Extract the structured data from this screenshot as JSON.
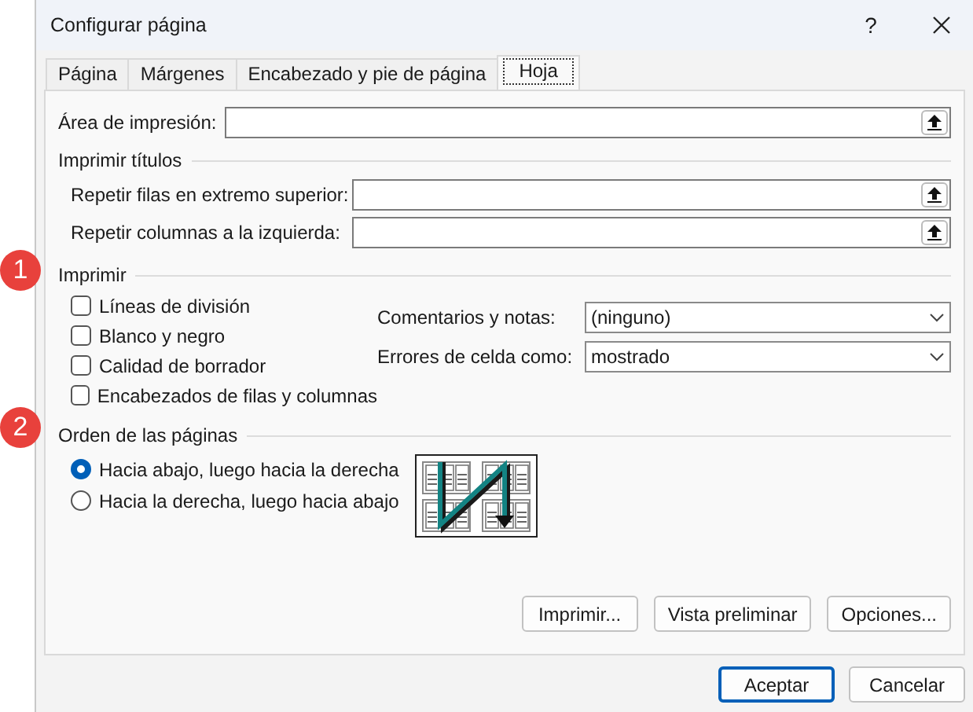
{
  "window": {
    "title": "Configurar página",
    "help": "?"
  },
  "tabs": [
    {
      "label": "Página",
      "selected": false
    },
    {
      "label": "Márgenes",
      "selected": false
    },
    {
      "label": "Encabezado y pie de página",
      "selected": false
    },
    {
      "label": "Hoja",
      "selected": true
    }
  ],
  "print_area": {
    "label": "Área de impresión:"
  },
  "print_titles": {
    "title": "Imprimir títulos",
    "fields": [
      {
        "label": "Repetir filas en extremo superior:"
      },
      {
        "label": "Repetir columnas a la izquierda:"
      }
    ]
  },
  "print": {
    "title": "Imprimir",
    "callout": "1",
    "options": [
      {
        "label": "Líneas de división",
        "checked": false
      },
      {
        "label": "Blanco y negro",
        "checked": false
      },
      {
        "label": "Calidad de borrador",
        "checked": false
      },
      {
        "label": "Encabezados de filas y columnas",
        "checked": false
      }
    ],
    "dropdowns": [
      {
        "label": "Comentarios y notas:",
        "value": "(ninguno)"
      },
      {
        "label": "Errores de celda como:",
        "value": "mostrado"
      }
    ]
  },
  "page_order": {
    "title": "Orden de las páginas",
    "callout": "2",
    "options": [
      {
        "label": "Hacia abajo, luego hacia la derecha",
        "selected": true
      },
      {
        "label": "Hacia la derecha, luego hacia abajo",
        "selected": false
      }
    ]
  },
  "sheet_buttons": [
    "Imprimir...",
    "Vista preliminar",
    "Opciones..."
  ],
  "dialog_buttons": [
    {
      "label": "Aceptar",
      "default": true
    },
    {
      "label": "Cancelar",
      "default": false
    }
  ]
}
